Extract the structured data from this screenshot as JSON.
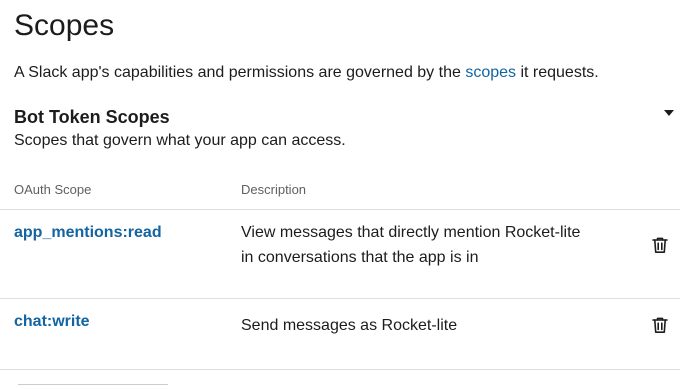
{
  "page": {
    "title": "Scopes",
    "intro_before": "A Slack app's capabilities and permissions are governed by the ",
    "intro_link": "scopes",
    "intro_after": " it requests."
  },
  "bot_section": {
    "title": "Bot Token Scopes",
    "subtitle": "Scopes that govern what your app can access.",
    "toggle_icon": "caret-down-icon",
    "columns": {
      "scope": "OAuth Scope",
      "description": "Description"
    },
    "rows": [
      {
        "scope": "app_mentions:read",
        "description": "View messages that directly mention Rocket-lite in conversations that the app is in",
        "action_icon": "trash-icon"
      },
      {
        "scope": "chat:write",
        "description": "Send messages as Rocket-lite",
        "action_icon": "trash-icon"
      }
    ]
  },
  "colors": {
    "link": "#1264a3",
    "text": "#1d1c1d",
    "muted": "#616061",
    "divider": "#dddddd"
  }
}
